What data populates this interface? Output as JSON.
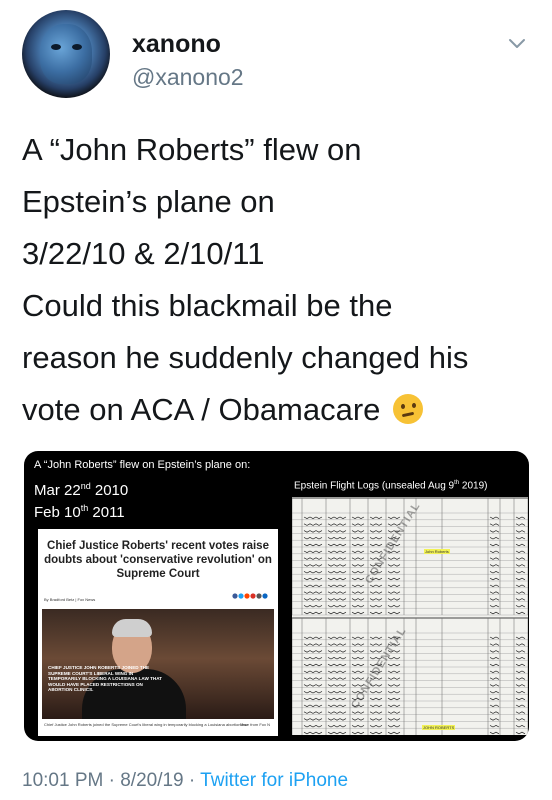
{
  "user": {
    "display_name": "xanono",
    "handle": "@xanono2",
    "avatar_icon": "avatar-portrait"
  },
  "tweet": {
    "lines": [
      "A “John Roberts” flew on",
      "Epstein’s plane on",
      "3/22/10 & 2/10/11",
      "Could this blackmail be the",
      "reason he suddenly changed his",
      "vote on ACA / Obamacare"
    ],
    "emoji": "thinking-face-emoji"
  },
  "media": {
    "caption": "A “John Roberts” flew on Epstein’s plane on:",
    "date1_main": "Mar 22",
    "date1_sup": "nd",
    "date1_year": " 2010",
    "date2_main": "Feb 10",
    "date2_sup": "th",
    "date2_year": " 2011",
    "news_headline": "Chief Justice Roberts' recent votes raise doubts about 'conservative revolution' on Supreme Court",
    "news_byline": "By Bradford Betz | Fox News",
    "photo_caption": "CHIEF JUSTICE JOHN ROBERTS JOINED THE SUPREME COURT'S LIBERAL WING IN TEMPORARILY BLOCKING A LOUISIANA LAW THAT WOULD HAVE PLACED RESTRICTIONS ON ABORTION CLINICS.",
    "news_footer": "Chief Justice John Roberts joined the Supreme Court's liberal wing in temporarily blocking a Louisiana abortion law",
    "news_footer_right": "More from Fox N",
    "logs_title_main": "Epstein Flight Logs (unsealed Aug 9",
    "logs_title_sup": "th",
    "logs_title_end": " 2019)",
    "stamp": "CONFIDENTIAL",
    "highlight_1": "John Roberts",
    "highlight_2": "JOHN ROBERTS"
  },
  "meta": {
    "time": "10:01 PM",
    "date": "8/20/19",
    "separator": " · ",
    "source": "Twitter for iPhone"
  },
  "colors": {
    "accent": "#1da1f2",
    "secondary_text": "#657786",
    "primary_text": "#14171a",
    "highlighter": "#f2f255"
  }
}
